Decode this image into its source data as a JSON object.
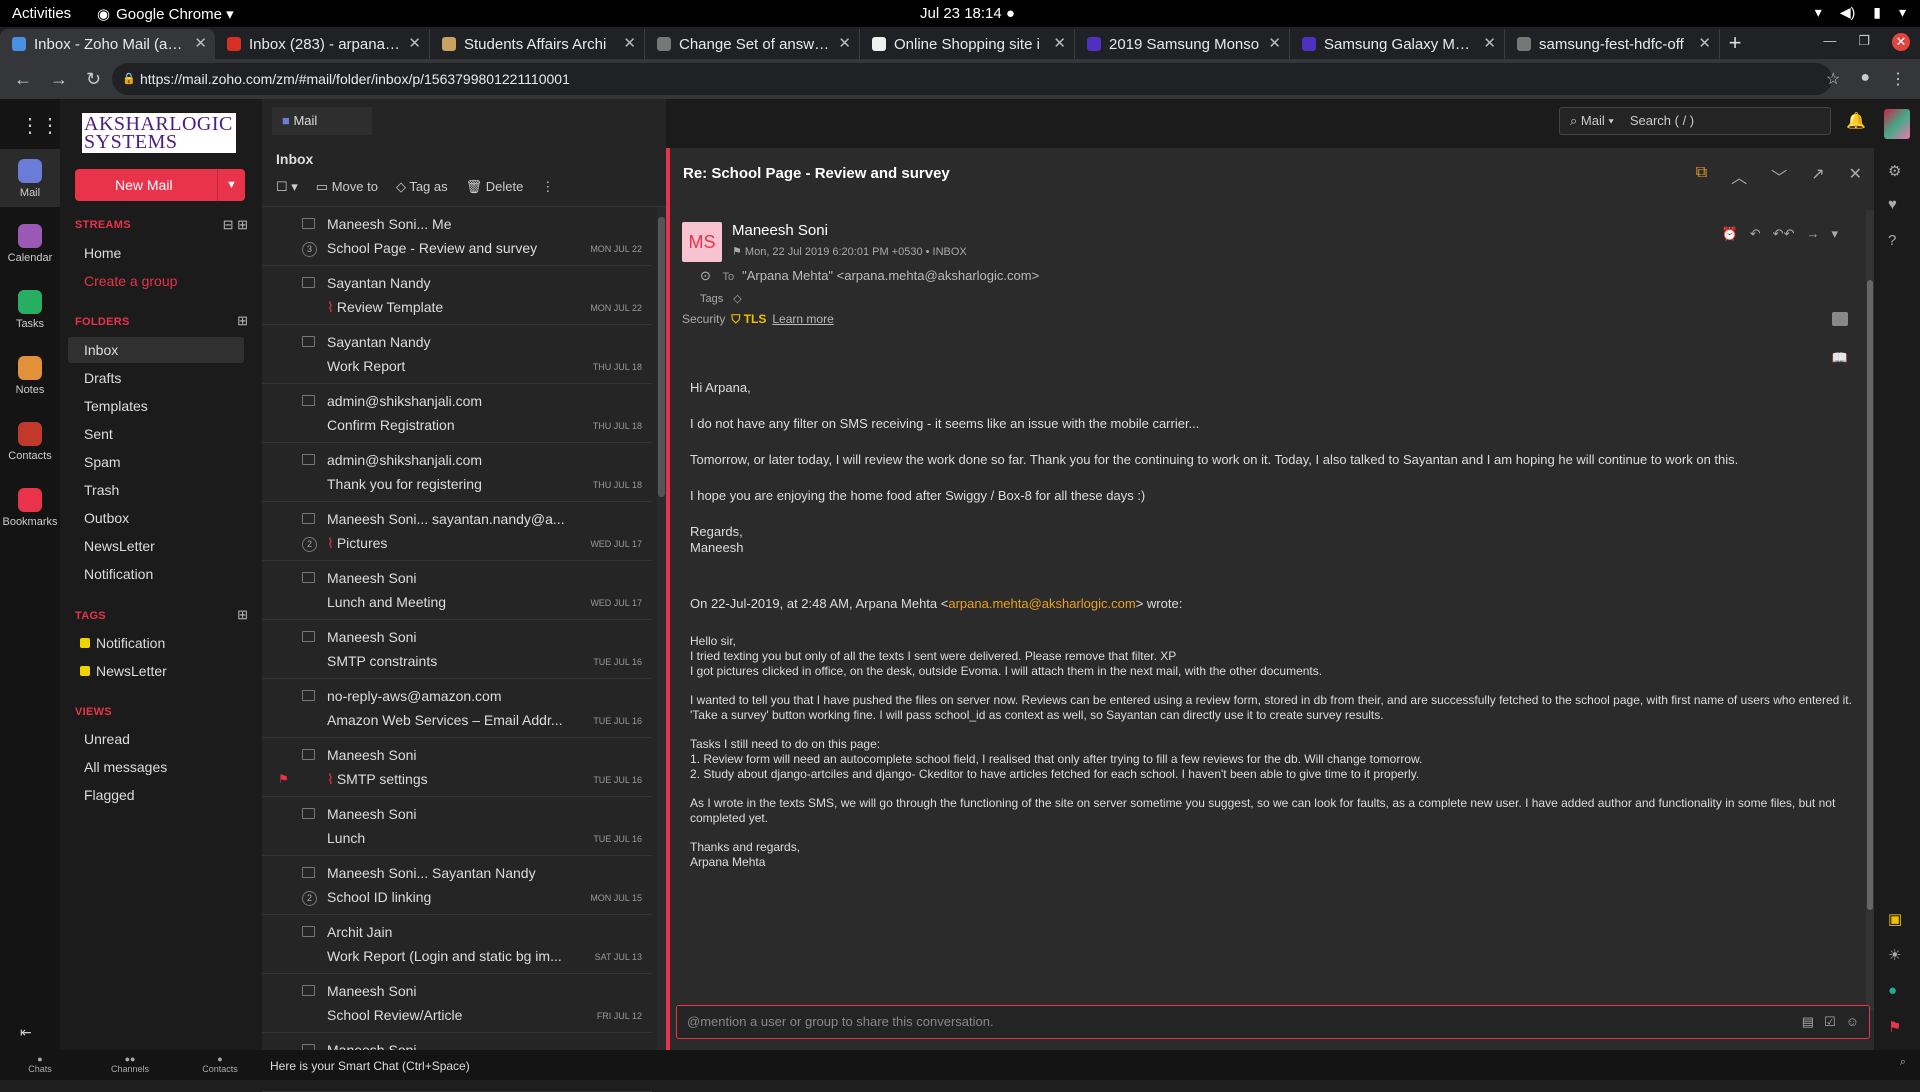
{
  "os": {
    "activities": "Activities",
    "app_name": "Google Chrome ▾",
    "clock": "Jul 23  18:14 ●"
  },
  "tabs": [
    {
      "title": "Inbox - Zoho Mail (arpa",
      "color": "#4a90e2"
    },
    {
      "title": "Inbox (283) - arpana11:",
      "color": "#d93025"
    },
    {
      "title": "Students Affairs Archi",
      "color": "#c8a060"
    },
    {
      "title": "Change Set of answers",
      "color": "#777777"
    },
    {
      "title": "Online Shopping site i",
      "color": "#f0f0f0"
    },
    {
      "title": "2019 Samsung Monso",
      "color": "#5030c0"
    },
    {
      "title": "Samsung Galaxy M30 (",
      "color": "#5030c0"
    },
    {
      "title": "samsung-fest-hdfc-off",
      "color": "#777777"
    }
  ],
  "url": "https://mail.zoho.com/zm/#mail/folder/inbox/p/1563799801221110001",
  "rail": [
    {
      "label": "Mail",
      "color": "#6a7bd8"
    },
    {
      "label": "Calendar",
      "color": "#9b59b6"
    },
    {
      "label": "Tasks",
      "color": "#27ae60"
    },
    {
      "label": "Notes",
      "color": "#e0913a"
    },
    {
      "label": "Contacts",
      "color": "#c0392b"
    },
    {
      "label": "Bookmarks",
      "color": "#e8334a"
    }
  ],
  "brand": {
    "logo_line1": "AKSHARLOGIC",
    "logo_line2": "SYSTEMS",
    "accent": "#e8334a"
  },
  "sidebar": {
    "new_mail": "New Mail",
    "streams_head": "STREAMS",
    "streams": [
      "Home",
      "Create a group"
    ],
    "folders_head": "FOLDERS",
    "folders": [
      "Inbox",
      "Drafts",
      "Templates",
      "Sent",
      "Spam",
      "Trash",
      "Outbox",
      "NewsLetter",
      "Notification"
    ],
    "tags_head": "TAGS",
    "tags": [
      "Notification",
      "NewsLetter"
    ],
    "views_head": "VIEWS",
    "views": [
      "Unread",
      "All messages",
      "Flagged"
    ]
  },
  "list": {
    "mail_tab": "Mail",
    "title": "Inbox",
    "toolbar": {
      "move": "Move to",
      "tag": "Tag as",
      "delete": "Delete"
    },
    "rows": [
      {
        "sender": "Maneesh Soni... Me",
        "subject": "School Page - Review and survey",
        "date": "MON JUL 22",
        "count": "3"
      },
      {
        "sender": "Sayantan Nandy",
        "subject": "Review Template",
        "date": "MON JUL 22",
        "clip": "⌇"
      },
      {
        "sender": "Sayantan Nandy",
        "subject": "Work Report",
        "date": "THU JUL 18"
      },
      {
        "sender": "admin@shikshanjali.com",
        "subject": "Confirm Registration",
        "date": "THU JUL 18"
      },
      {
        "sender": "admin@shikshanjali.com",
        "subject": "Thank you for registering",
        "date": "THU JUL 18"
      },
      {
        "sender": "Maneesh Soni... sayantan.nandy@a...",
        "subject": "Pictures",
        "date": "WED JUL 17",
        "count": "2",
        "clip": "⌇"
      },
      {
        "sender": "Maneesh Soni",
        "subject": "Lunch and Meeting",
        "date": "WED JUL 17"
      },
      {
        "sender": "Maneesh Soni",
        "subject": "SMTP constraints",
        "date": "TUE JUL 16"
      },
      {
        "sender": "no-reply-aws@amazon.com",
        "subject": "Amazon Web Services – Email Addr...",
        "date": "TUE JUL 16"
      },
      {
        "sender": "Maneesh Soni",
        "subject": "SMTP settings",
        "date": "TUE JUL 16",
        "clip": "⌇",
        "flag": "⚑"
      },
      {
        "sender": "Maneesh Soni",
        "subject": "Lunch",
        "date": "TUE JUL 16"
      },
      {
        "sender": "Maneesh Soni... Sayantan Nandy",
        "subject": "School ID linking",
        "date": "MON JUL 15",
        "count": "2"
      },
      {
        "sender": "Archit Jain",
        "subject": "Work Report (Login and static bg im...",
        "date": "SAT JUL 13"
      },
      {
        "sender": "Maneesh Soni",
        "subject": "School Review/Article",
        "date": "FRI JUL 12"
      },
      {
        "sender": "Maneesh Soni",
        "subject": "",
        "date": ""
      }
    ]
  },
  "top": {
    "search_scope": "Mail ▾",
    "search_placeholder": "Search ( / )"
  },
  "reader": {
    "subject": "Re: School Page - Review and survey",
    "initials": "MS",
    "from": "Maneesh Soni",
    "meta": "Mon, 22 Jul 2019 6:20:01 PM +0530   •   INBOX",
    "to_label": "To",
    "to": "\"Arpana Mehta\" <arpana.mehta@aksharlogic.com>",
    "tags_label": "Tags",
    "security_label": "Security",
    "tls": "TLS",
    "learn_more": "Learn more",
    "body": {
      "p1": "Hi Arpana,",
      "p2": "I do not have any filter on SMS receiving - it seems like an issue with the mobile carrier...",
      "p3": "Tomorrow, or later today, I will review the work done so far. Thank you for the continuing to work on it. Today, I also talked to Sayantan and I am hoping he will continue to work on this.",
      "p4": "I hope you are enjoying the home food after Swiggy / Box-8 for all these days :)",
      "p5a": "Regards,",
      "p5b": "Maneesh",
      "q_pre": "On 22-Jul-2019, at 2:48 AM, Arpana Mehta <",
      "q_email": "arpana.mehta@aksharlogic.com",
      "q_post": "> wrote:",
      "r1": "Hello sir,",
      "r2": "I tried texting you but only of all the texts I sent were delivered. Please remove that filter. XP",
      "r3": "I got pictures clicked in office, on the desk, outside Evoma. I will attach them in the next mail, with the other documents.",
      "r4": "I wanted to tell you that I have pushed the files on server now. Reviews can be entered using a review form, stored in db from their, and are successfully fetched to the school page, with first name of users who entered it.",
      "r5": "'Take a survey' button working fine. I will pass school_id as context as well, so Sayantan can directly use it to create survey results.",
      "r6": "Tasks I still need to do on this page:",
      "r7": "1. Review form will need an autocomplete school field, I realised that only after trying to fill a few reviews for the db. Will change tomorrow.",
      "r8": "2. Study about django-artciles and django- Ckeditor to have articles fetched for each school. I haven't been able to give time to it properly.",
      "r9": "As I wrote in the texts SMS, we will go through the functioning of the site on server sometime you suggest, so we can look for faults, as a complete new user. I have added author and functionality in some files, but not completed yet.",
      "r10": "Thanks and regards,",
      "r11": "Arpana Mehta"
    },
    "compose_placeholder": "@mention a user or group to share this conversation."
  },
  "bottom": {
    "chats": "Chats",
    "channels": "Channels",
    "contacts": "Contacts",
    "smart_chat": "Here is your Smart Chat (Ctrl+Space)"
  }
}
